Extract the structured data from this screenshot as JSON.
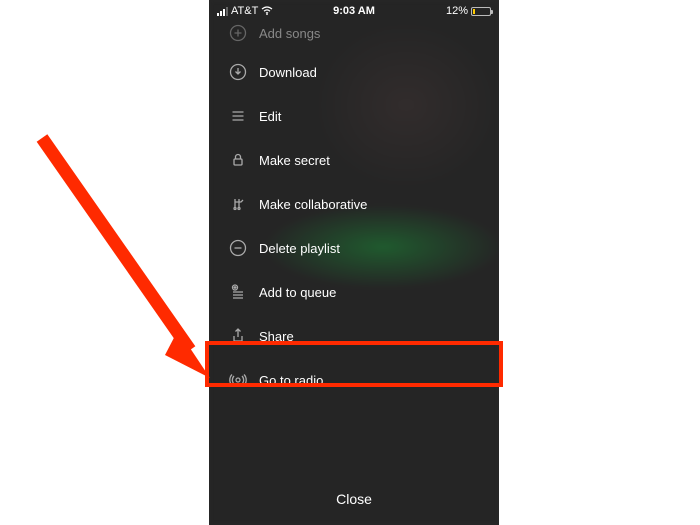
{
  "statusBar": {
    "carrier": "AT&T",
    "time": "9:03 AM",
    "batteryPercent": "12%"
  },
  "menu": {
    "addSongs": "Add songs",
    "download": "Download",
    "edit": "Edit",
    "makeSecret": "Make secret",
    "makeCollaborative": "Make collaborative",
    "deletePlaylist": "Delete playlist",
    "addToQueue": "Add to queue",
    "share": "Share",
    "goToRadio": "Go to radio"
  },
  "close": "Close",
  "annotation": {
    "arrowColor": "#ff2a00",
    "highlightColor": "#ff2a00"
  }
}
